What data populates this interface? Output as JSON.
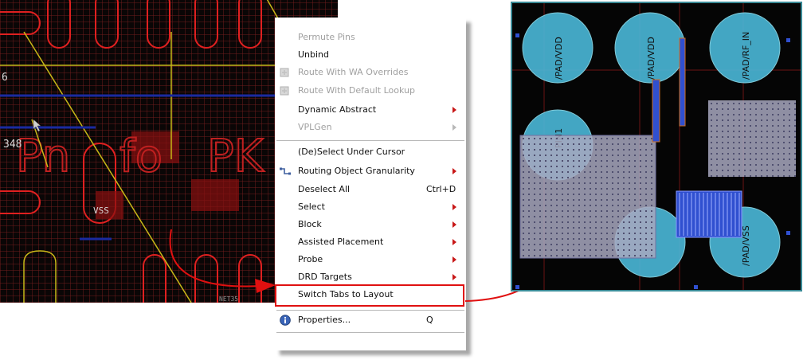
{
  "left_layout": {
    "labels": {
      "number_6": "6",
      "number_348": "348",
      "net_vss": "VSS",
      "net_bottom": "NET35"
    }
  },
  "menu": {
    "items": [
      {
        "label": "Permute Pins",
        "disabled": true
      },
      {
        "label": "Unbind"
      },
      {
        "label": "Route With WA Overrides",
        "disabled": true
      },
      {
        "label": "Route With Default Lookup",
        "disabled": true
      },
      {
        "label": "Dynamic Abstract",
        "submenu": true
      },
      {
        "label": "VPLGen",
        "disabled": true,
        "submenu": true
      },
      {
        "label": "(De)Select Under Cursor"
      },
      {
        "label": "Routing Object Granularity",
        "submenu": true
      },
      {
        "label": "Deselect All",
        "shortcut": "Ctrl+D"
      },
      {
        "label": "Select",
        "submenu": true
      },
      {
        "label": "Block",
        "submenu": true
      },
      {
        "label": "Assisted Placement",
        "submenu": true
      },
      {
        "label": "Probe",
        "submenu": true
      },
      {
        "label": "DRD Targets",
        "submenu": true
      },
      {
        "label": "Switch Tabs to Layout",
        "highlighted": true
      },
      {
        "label": "Properties...",
        "shortcut": "Q"
      }
    ]
  },
  "right_layout": {
    "pads": [
      "/PAD/VDD",
      "/PAD/VDD",
      "/PAD/RF_IN",
      "PIN1",
      "/PAD/VSS"
    ]
  },
  "colors": {
    "arrow": "#e01010",
    "menu_highlight_border": "#e01010",
    "submenu_arrow": "#c81818",
    "pad_fill": "#4ab8d8",
    "block_fill": "#a8a8c0"
  }
}
